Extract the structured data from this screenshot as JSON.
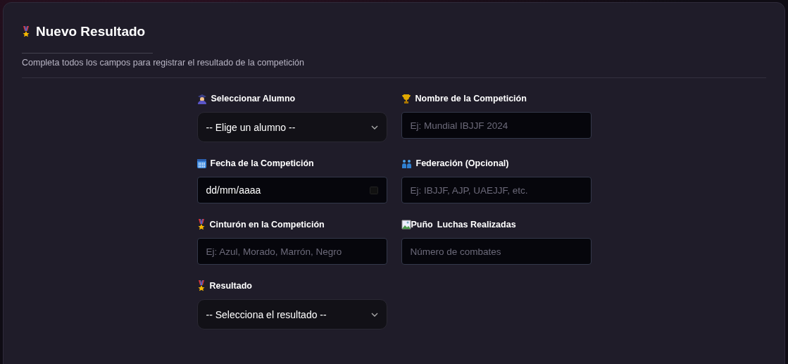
{
  "card": {
    "title": "Nuevo Resultado",
    "subtitle": "Completa todos los campos para registrar el resultado de la competición"
  },
  "fields": [
    {
      "kind": "select",
      "label": "Seleccionar Alumno",
      "value": "-- Elige un alumno --"
    },
    {
      "kind": "text",
      "label": "Nombre de la Competición",
      "placeholder": "Ej: Mundial IBJJF 2024"
    },
    {
      "kind": "date",
      "label": "Fecha de la Competición",
      "value": "dd/mm/aaaa"
    },
    {
      "kind": "text",
      "label": "Federación (Opcional)",
      "placeholder": "Ej: IBJJF, AJP, UAEJJF, etc."
    },
    {
      "kind": "text",
      "label": "Cinturón en la Competición",
      "placeholder": "Ej: Azul, Morado, Marrón, Negro"
    },
    {
      "kind": "text",
      "label": "Luchas Realizadas",
      "icon_alt": "Puño",
      "placeholder": "Número de combates"
    },
    {
      "kind": "select",
      "label": "Resultado",
      "value": "-- Selecciona el resultado --"
    }
  ]
}
